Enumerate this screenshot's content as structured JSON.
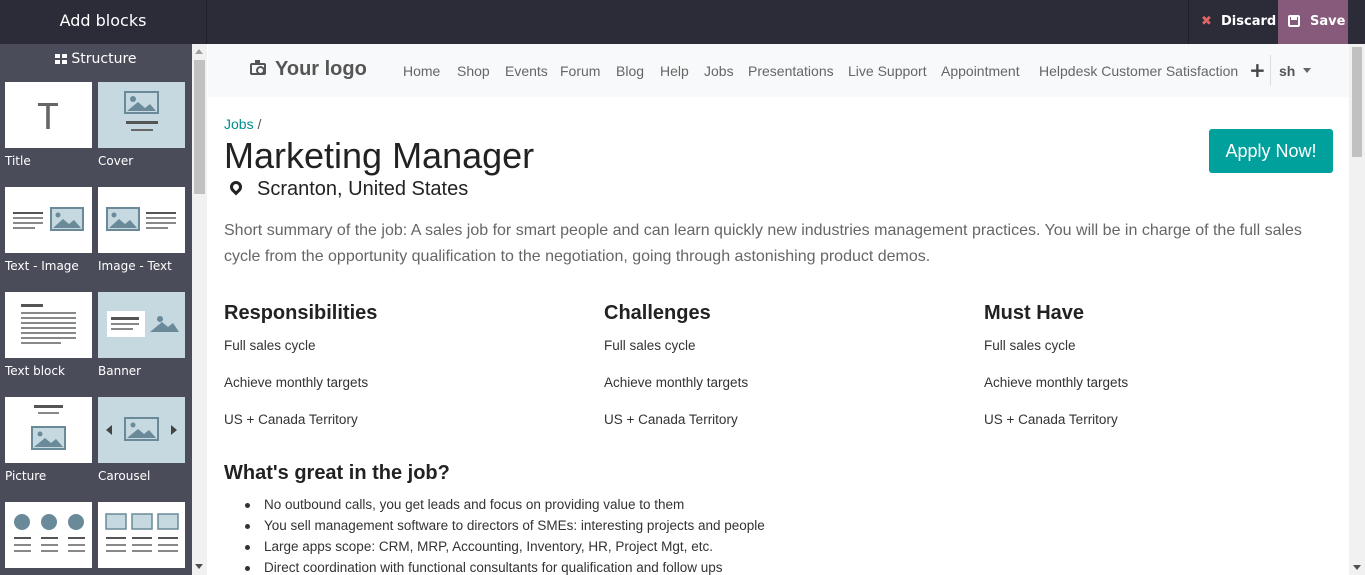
{
  "editor": {
    "panel_title": "Add blocks",
    "discard_label": "Discard",
    "save_label": "Save"
  },
  "sidebar": {
    "category": "Structure",
    "snippets": [
      {
        "label": "Title"
      },
      {
        "label": "Cover"
      },
      {
        "label": "Text - Image"
      },
      {
        "label": "Image - Text"
      },
      {
        "label": "Text block"
      },
      {
        "label": "Banner"
      },
      {
        "label": "Picture"
      },
      {
        "label": "Carousel"
      },
      {
        "label": ""
      },
      {
        "label": ""
      }
    ]
  },
  "navbar": {
    "logo": "Your logo",
    "items": [
      "Home",
      "Shop",
      "Events",
      "Forum",
      "Blog",
      "Help",
      "Jobs",
      "Presentations",
      "Live Support",
      "Appointment",
      "Helpdesk Customer Satisfaction"
    ],
    "plus": "+",
    "user": "sh"
  },
  "job": {
    "breadcrumb_link": "Jobs",
    "breadcrumb_sep": "/",
    "title": "Marketing Manager",
    "location": "Scranton, United States",
    "apply_label": "Apply Now!",
    "summary": "Short summary of the job: A sales job for smart people and can learn quickly new industries management practices. You will be in charge of the full sales cycle from the opportunity qualification to the negotiation, going through astonishing product demos.",
    "columns": [
      {
        "heading": "Responsibilities",
        "items": [
          "Full sales cycle",
          "Achieve monthly targets",
          "US + Canada Territory"
        ]
      },
      {
        "heading": "Challenges",
        "items": [
          "Full sales cycle",
          "Achieve monthly targets",
          "US + Canada Territory"
        ]
      },
      {
        "heading": "Must Have",
        "items": [
          "Full sales cycle",
          "Achieve monthly targets",
          "US + Canada Territory"
        ]
      }
    ],
    "great_heading": "What's great in the job?",
    "great_items": [
      "No outbound calls, you get leads and focus on providing value to them",
      "You sell management software to directors of SMEs: interesting projects and people",
      "Large apps scope: CRM, MRP, Accounting, Inventory, HR, Project Mgt, etc.",
      "Direct coordination with functional consultants for qualification and follow ups"
    ]
  },
  "colors": {
    "editor_bar": "#2b2c38",
    "sidebar": "#4a4c5a",
    "save_bg": "#875a7b",
    "primary": "#00a09d",
    "link": "#008f8c"
  }
}
